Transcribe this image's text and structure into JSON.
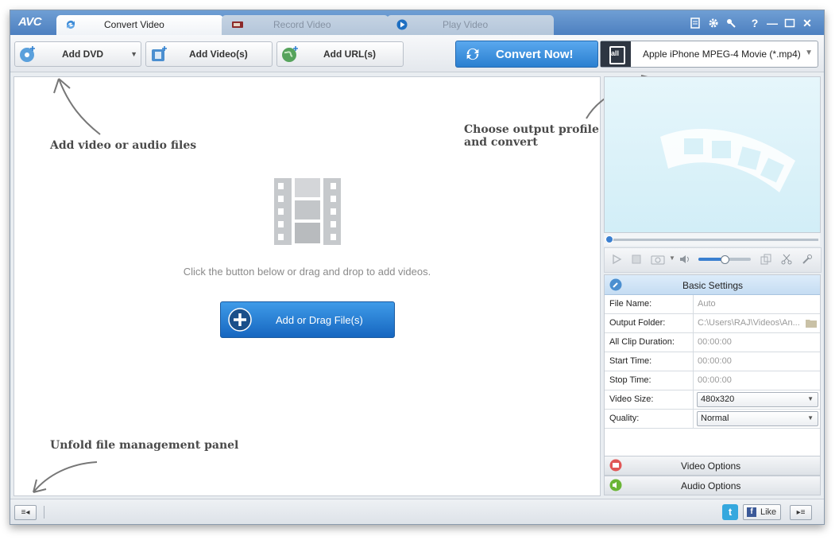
{
  "app": {
    "logo": "AVC"
  },
  "tabs": [
    {
      "label": "Convert Video",
      "active": true
    },
    {
      "label": "Record Video",
      "active": false
    },
    {
      "label": "Play Video",
      "active": false
    }
  ],
  "titlebar_icons": [
    "skin-icon",
    "gear-icon",
    "key-icon",
    "help-icon",
    "minimize-icon",
    "maximize-icon",
    "close-icon"
  ],
  "titlebar_glyphs": {
    "help": "?",
    "minimize": "—",
    "close": "✕"
  },
  "toolbar": {
    "add_dvd": "Add DVD",
    "add_videos": "Add Video(s)",
    "add_urls": "Add URL(s)",
    "convert_now": "Convert Now!",
    "profile": "Apple iPhone MPEG-4 Movie (*.mp4)",
    "profile_icon_text": "all"
  },
  "main": {
    "hint_add": "Add video or audio files",
    "hint_profile": "Choose output profile and convert",
    "hint_unfold": "Unfold file management panel",
    "drop_text": "Click the button below or drag and drop to add videos.",
    "add_drag_button": "Add or Drag File(s)"
  },
  "settings": {
    "header": "Basic Settings",
    "rows": [
      {
        "key": "File Name:",
        "value": "Auto"
      },
      {
        "key": "Output Folder:",
        "value": "C:\\Users\\RAJ\\Videos\\An..."
      },
      {
        "key": "All Clip Duration:",
        "value": "00:00:00"
      },
      {
        "key": "Start Time:",
        "value": "00:00:00"
      },
      {
        "key": "Stop Time:",
        "value": "00:00:00"
      },
      {
        "key": "Video Size:",
        "value": "480x320"
      },
      {
        "key": "Quality:",
        "value": "Normal"
      }
    ],
    "video_options": "Video Options",
    "audio_options": "Audio Options"
  },
  "statusbar": {
    "like": "Like"
  },
  "colors": {
    "accent": "#2a7fd0",
    "titlebar": "#5a8cc9",
    "preview_bg": "#d8f0f8"
  }
}
